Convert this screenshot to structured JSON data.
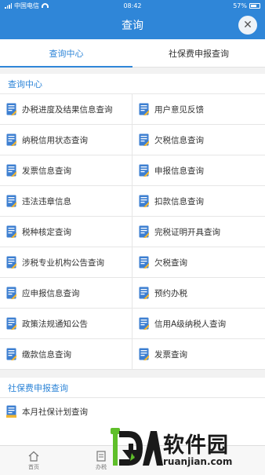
{
  "status_bar": {
    "carrier": "中国电信",
    "time": "08:42",
    "battery": "57%"
  },
  "header": {
    "title": "查询",
    "close_glyph": "✕"
  },
  "tabs": [
    {
      "label": "查询中心",
      "active": true
    },
    {
      "label": "社保费申报查询",
      "active": false
    }
  ],
  "section1": {
    "title": "查询中心",
    "items": [
      "办税进度及结果信息查询",
      "用户意见反馈",
      "纳税信用状态查询",
      "欠税信息查询",
      "发票信息查询",
      "申报信息查询",
      "违法违章信息",
      "扣款信息查询",
      "税种核定查询",
      "完税证明开具查询",
      "涉税专业机构公告查询",
      "欠税查询",
      "应申报信息查询",
      "预约办税",
      "政策法规通知公告",
      "信用A级纳税人查询",
      "缴款信息查询",
      "发票查询"
    ]
  },
  "section2": {
    "title": "社保费申报查询",
    "items": [
      "本月社保计划查询"
    ]
  },
  "bottom_nav": [
    {
      "label": "首页",
      "icon": "home-icon"
    },
    {
      "label": "办税",
      "icon": "tax-icon"
    }
  ],
  "watermark": {
    "brand": "软件园",
    "url": "ruanjian.com"
  },
  "colors": {
    "accent": "#2f86d8",
    "icon_blue": "#3d7fd1",
    "icon_yellow": "#f2b632"
  }
}
